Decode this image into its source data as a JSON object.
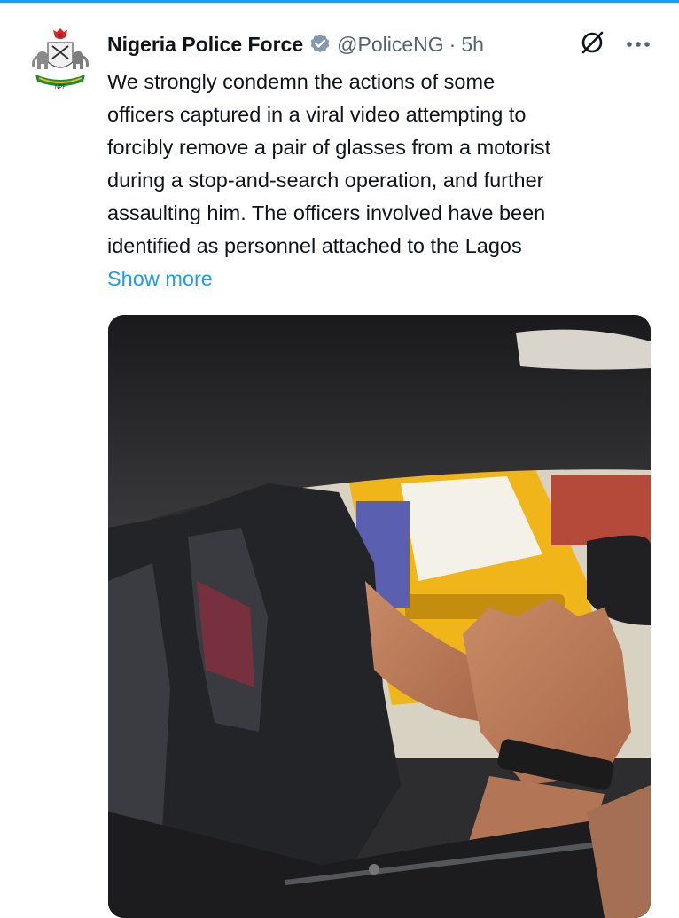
{
  "tweet": {
    "author_name": "Nigeria Police Force",
    "handle": "@PoliceNG",
    "separator": "·",
    "time": "5h",
    "text_lines": [
      "We strongly condemn the actions of some",
      "officers captured in a viral video attempting to",
      "forcibly remove a pair of glasses from a motorist",
      "during a stop-and-search operation, and further",
      "assaulting him. The officers involved have been",
      "identified as personnel attached to the Lagos"
    ],
    "show_more_label": "Show more",
    "avatar_logo_text": "NPF"
  },
  "icons": {
    "verified": "verified-badge-icon",
    "grok": "grok-icon",
    "more": "more-dots-icon"
  },
  "colors": {
    "accent": "#1d9bf0",
    "text_primary": "#0f1419",
    "text_secondary": "#536471",
    "verified_badge": "#829aab"
  }
}
